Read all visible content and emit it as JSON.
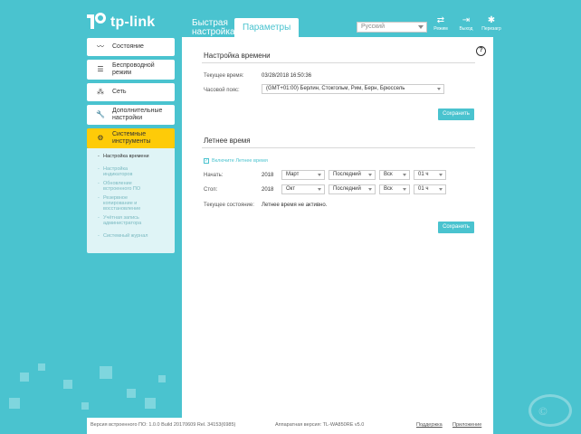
{
  "brand": {
    "name": "tp-link"
  },
  "top_tabs": [
    {
      "label": "Быстрая настройка",
      "active": false
    },
    {
      "label": "Параметры",
      "active": true
    }
  ],
  "language": {
    "selected": "Русский"
  },
  "header_actions": [
    {
      "label": "Режим",
      "icon": "mode-icon"
    },
    {
      "label": "Выход",
      "icon": "logout-icon"
    },
    {
      "label": "Перезагр",
      "icon": "reboot-icon"
    }
  ],
  "sidebar": {
    "items": [
      {
        "label": "Состояние",
        "icon": "pulse-icon"
      },
      {
        "label": "Беспроводной режим",
        "icon": "wireless-icon"
      },
      {
        "label": "Сеть",
        "icon": "network-icon"
      },
      {
        "label": "Дополнительные настройки",
        "icon": "wrench-icon"
      },
      {
        "label": "Системные инструменты",
        "icon": "gear-icon",
        "active": true
      }
    ],
    "submenu": [
      {
        "label": "Настройка времени",
        "active": true
      },
      {
        "label": "Настройка индикаторов"
      },
      {
        "label": "Обновление встроенного ПО"
      },
      {
        "label": "Резервное копирование и восстановление"
      },
      {
        "label": "Учётная запись администратора"
      },
      {
        "label": "Системный журнал"
      }
    ]
  },
  "time_settings": {
    "title": "Настройка времени",
    "current_time_label": "Текущее время:",
    "current_time_value": "03/28/2018 16:50:36",
    "timezone_label": "Часовой пояс:",
    "timezone_value": "(GMT+01:00) Берлин, Стокгольм, Рим, Берн, Брюссель",
    "save_label": "Сохранить"
  },
  "dst": {
    "title": "Летнее время",
    "enable_label": "Включите Летнее время",
    "start_label": "Начать:",
    "start": {
      "year": "2018",
      "month": "Март",
      "week": "Последний",
      "day": "Вск",
      "hour": "01 ч"
    },
    "stop_label": "Стоп:",
    "stop": {
      "year": "2018",
      "month": "Окт",
      "week": "Последний",
      "day": "Вск",
      "hour": "01 ч"
    },
    "status_label": "Текущее состояние:",
    "status_value": "Летнее время не активно.",
    "save_label": "Сохранить"
  },
  "footer": {
    "firmware": "Версия встроенного ПО: 1.0.0 Build 20170609 Rel. 34153(6985)",
    "hardware": "Аппаратная версия: TL-WA850RE v5.0",
    "support_link": "Поддержка",
    "app_link": "Приложение"
  },
  "colors": {
    "accent": "#4ac3cf",
    "active_nav": "#fecb08"
  }
}
